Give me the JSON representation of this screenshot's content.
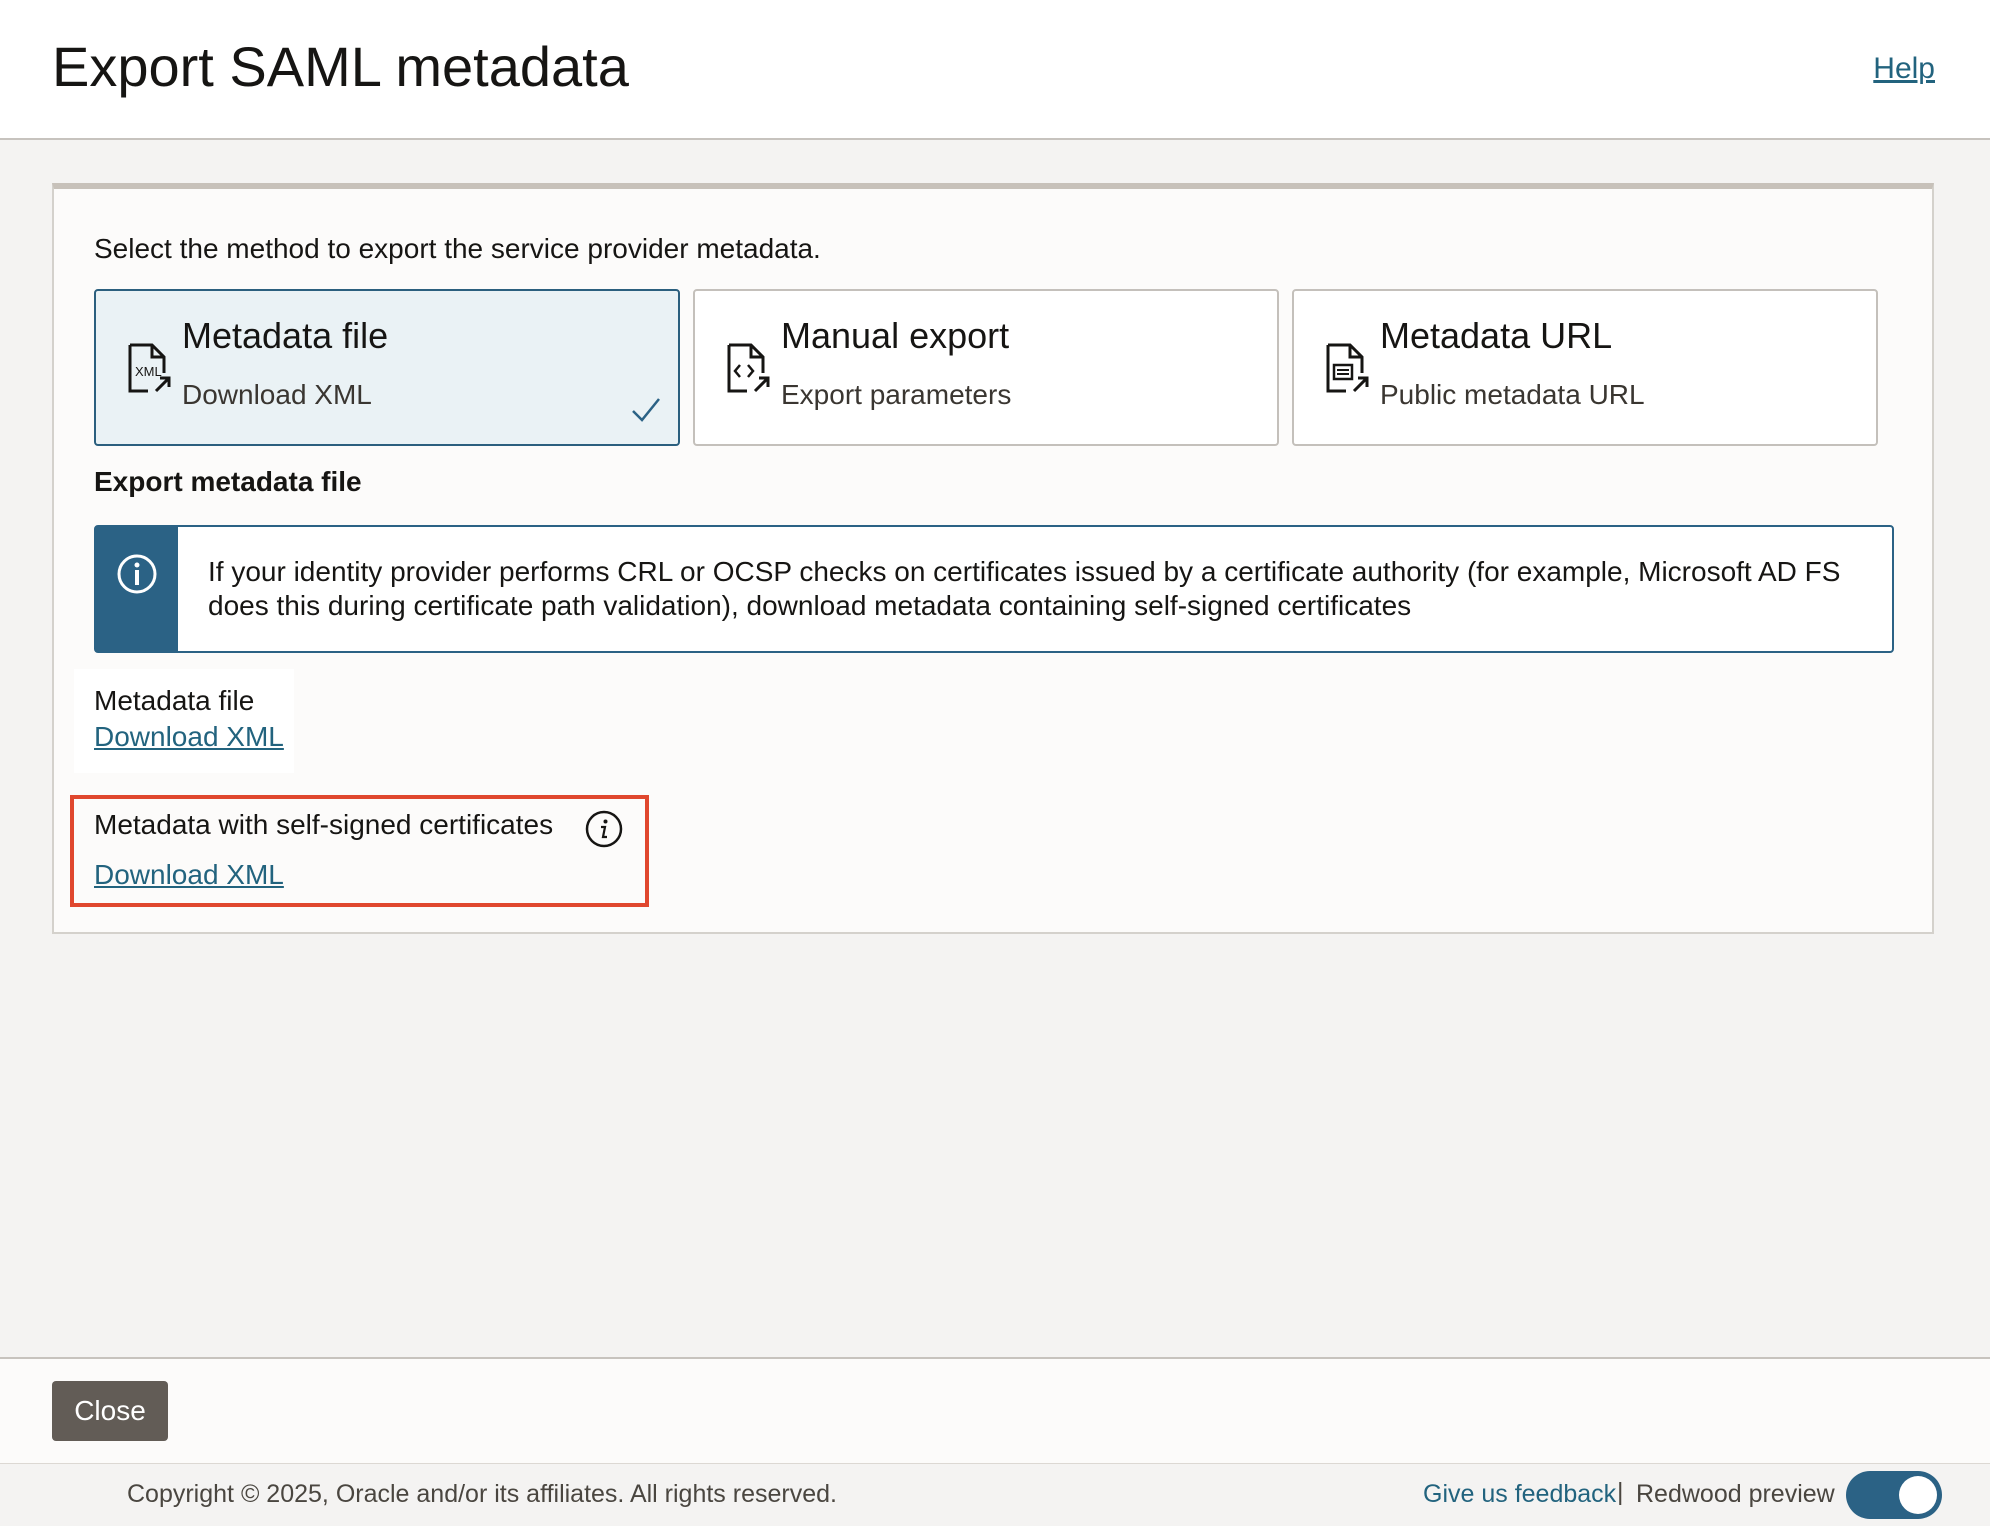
{
  "header": {
    "title": "Export SAML metadata",
    "help_label": "Help"
  },
  "panel": {
    "intro": "Select the method to export the service provider metadata.",
    "options": [
      {
        "title": "Metadata file",
        "subtitle": "Download XML",
        "selected": true,
        "icon": "xml-file-icon"
      },
      {
        "title": "Manual export",
        "subtitle": "Export parameters",
        "selected": false,
        "icon": "code-file-icon"
      },
      {
        "title": "Metadata URL",
        "subtitle": "Public metadata URL",
        "selected": false,
        "icon": "document-link-icon"
      }
    ],
    "section_heading": "Export metadata file",
    "info_message": "If your identity provider performs CRL or OCSP checks on certificates issued by a certificate authority (for example, Microsoft AD FS does this during certificate path validation), download metadata containing self-signed certificates",
    "metadata_file": {
      "label": "Metadata file",
      "link": "Download XML"
    },
    "self_signed": {
      "label": "Metadata with self-signed certificates",
      "link": "Download XML"
    }
  },
  "footer": {
    "close_label": "Close",
    "copyright": "Copyright © 2025, Oracle and/or its affiliates. All rights reserved.",
    "feedback_label": "Give us feedback",
    "separator": "|",
    "redwood_label": "Redwood preview",
    "redwood_enabled": true
  },
  "colors": {
    "accent": "#2b6285",
    "link": "#22637e",
    "highlight": "#e0472e",
    "close_button": "#625c56"
  }
}
